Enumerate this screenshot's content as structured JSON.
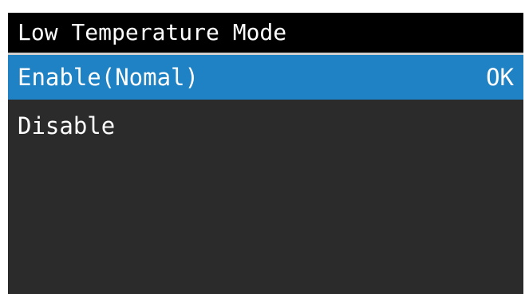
{
  "screen": {
    "title": "Low Temperature Mode",
    "items": [
      {
        "label": "Enable(Nomal)",
        "value": "OK",
        "selected": true
      },
      {
        "label": "Disable",
        "value": "",
        "selected": false
      }
    ]
  },
  "colors": {
    "title_background": "#000000",
    "screen_background": "#2b2b2b",
    "selection_highlight": "#1f82c4",
    "text": "#ffffff"
  }
}
